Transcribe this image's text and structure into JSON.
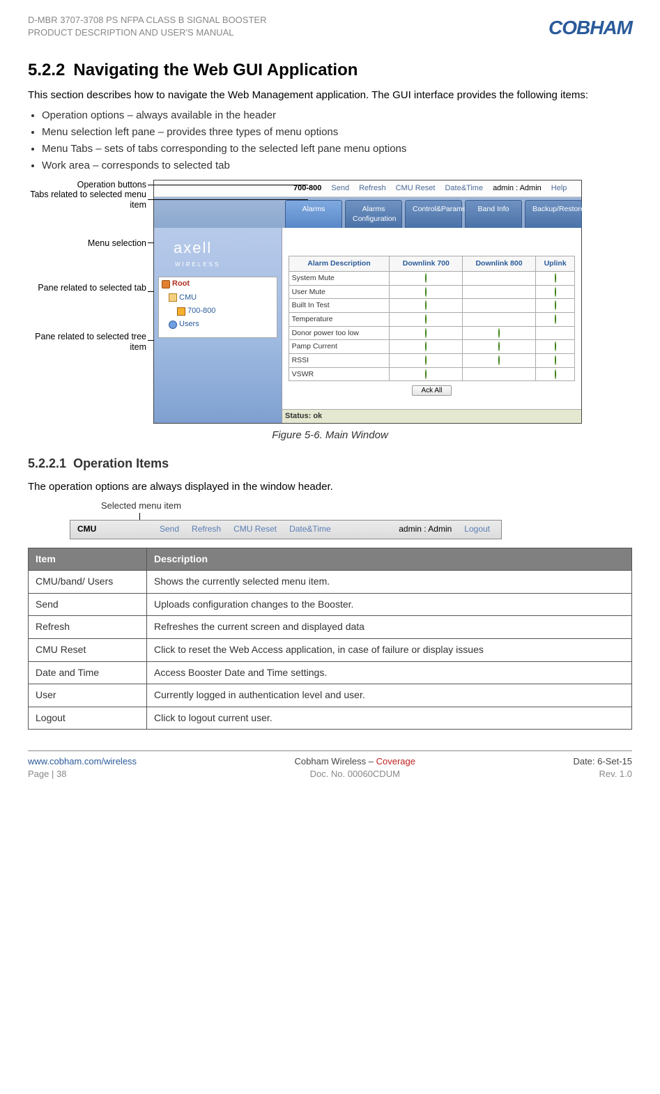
{
  "header": {
    "line1": "D-MBR 3707-3708 PS NFPA CLASS B SIGNAL BOOSTER",
    "line2": "PRODUCT DESCRIPTION AND USER'S MANUAL",
    "logo": "COBHAM"
  },
  "section": {
    "number": "5.2.2",
    "title": "Navigating the Web GUI Application",
    "intro": "This section describes how to navigate the Web Management application. The GUI interface provides the following items:",
    "bullets": [
      "Operation options – always available in the header",
      "Menu selection left pane – provides three types of menu options",
      "Menu Tabs – sets of tabs corresponding to the selected left pane menu options",
      "Work area – corresponds to selected tab"
    ]
  },
  "annots": {
    "a1": "Operation buttons",
    "a2": "Tabs related to selected menu item",
    "a3": "Menu selection",
    "a4": "Pane related to selected tab",
    "a5": "Pane related to selected tree item"
  },
  "mainwin": {
    "opbar": {
      "selected": "700-800",
      "items": [
        "Send",
        "Refresh",
        "CMU Reset",
        "Date&Time"
      ],
      "user": "admin : Admin",
      "help": "Help"
    },
    "tabs": [
      "Alarms",
      "Alarms Configuration",
      "Control&Params",
      "Band Info",
      "Backup/Restore"
    ],
    "sidebarLogo": "axell",
    "sidebarLogo2": "WIRELESS",
    "tree": {
      "root": "Root",
      "cmu": "CMU",
      "band": "700-800",
      "users": "Users"
    },
    "tableHeader": {
      "desc": "Alarm Description",
      "dl700": "Downlink 700",
      "dl800": "Downlink 800",
      "ul": "Uplink"
    },
    "rows": [
      {
        "name": "System Mute",
        "d7": true,
        "d8": false,
        "ul": true
      },
      {
        "name": "User Mute",
        "d7": true,
        "d8": false,
        "ul": true
      },
      {
        "name": "Built In Test",
        "d7": true,
        "d8": false,
        "ul": true
      },
      {
        "name": "Temperature",
        "d7": true,
        "d8": false,
        "ul": true
      },
      {
        "name": "Donor power too low",
        "d7": true,
        "d8": true,
        "ul": false
      },
      {
        "name": "Pamp Current",
        "d7": true,
        "d8": true,
        "ul": true
      },
      {
        "name": "RSSI",
        "d7": true,
        "d8": true,
        "ul": true
      },
      {
        "name": "VSWR",
        "d7": true,
        "d8": false,
        "ul": true
      }
    ],
    "ack": "Ack All",
    "status": "Status: ok"
  },
  "figcap": "Figure 5-6. Main Window",
  "sub": {
    "number": "5.2.2.1",
    "title": "Operation Items",
    "intro": "The operation options are always displayed in the window header.",
    "label": "Selected menu item",
    "bar": {
      "sel": "CMU",
      "items": [
        "Send",
        "Refresh",
        "CMU Reset",
        "Date&Time"
      ],
      "user": "admin : Admin",
      "logout": "Logout"
    }
  },
  "table": {
    "h1": "Item",
    "h2": "Description",
    "rows": [
      {
        "item": "CMU/band/ Users",
        "desc": "Shows the currently selected menu item."
      },
      {
        "item": "Send",
        "desc": "Uploads configuration changes to the Booster."
      },
      {
        "item": "Refresh",
        "desc": "Refreshes the current screen and displayed data"
      },
      {
        "item": "CMU Reset",
        "desc": "Click to reset the Web Access application, in case of failure or display issues"
      },
      {
        "item": "Date and Time",
        "desc": "Access Booster Date and Time settings."
      },
      {
        "item": "User",
        "desc": "Currently logged in authentication level and user."
      },
      {
        "item": "Logout",
        "desc": "Click to logout current user."
      }
    ]
  },
  "footer": {
    "url": "www.cobham.com/wireless",
    "page": "Page | 38",
    "center1a": "Cobham Wireless",
    "center1b": " – ",
    "center1c": "Coverage",
    "center2": "Doc. No. 00060CDUM",
    "date": "Date: 6-Set-15",
    "rev": "Rev. 1.0"
  }
}
